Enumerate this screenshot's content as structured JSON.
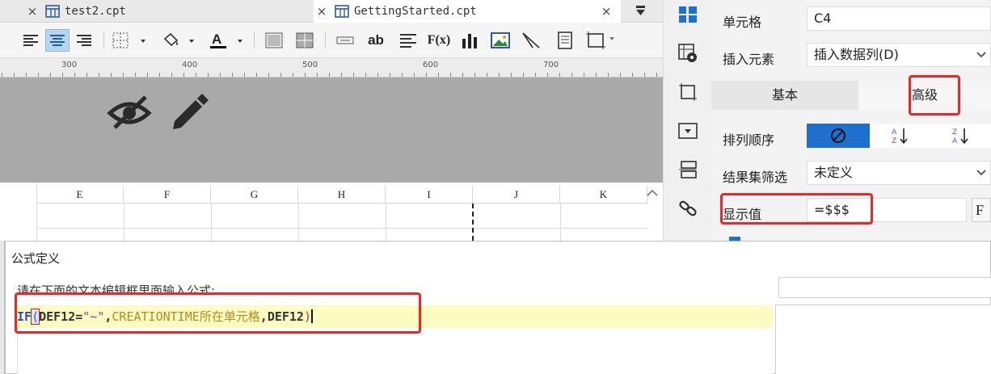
{
  "tabs": [
    {
      "name": "test2.cpt",
      "close": "×"
    },
    {
      "name": "GettingStarted.cpt",
      "close": "×"
    }
  ],
  "ruler": {
    "labels": [
      "300",
      "400",
      "500",
      "600",
      "700"
    ]
  },
  "toolbar": {
    "text_icon_ab": "ab",
    "formula_icon": "F(x)"
  },
  "grid": {
    "columns": [
      "E",
      "F",
      "G",
      "H",
      "I",
      "J",
      "K"
    ]
  },
  "props": {
    "cell_label": "单元格",
    "cell_value": "C4",
    "insert_label": "插入元素",
    "insert_value": "插入数据列(D)",
    "tab_basic": "基本",
    "tab_advanced": "高级",
    "sort_label": "排列顺序",
    "filter_label": "结果集筛选",
    "filter_value": "未定义",
    "display_label": "显示值",
    "display_value": "=$$$",
    "display_fx": "F"
  },
  "dialog": {
    "title": "公式定义",
    "prompt": "请在下面的文本编辑框里面输入公式:",
    "formula": {
      "fn": "IF",
      "open_paren": "(",
      "arg1": "DEF12=",
      "str": "\"~\"",
      "comma1": ",",
      "ident": "CREATIONTIME所在单元格",
      "comma2": ",",
      "arg3": "DEF12",
      "close_paren": ")"
    }
  },
  "colors": {
    "highlight": "#e8282b",
    "accent": "#1f6fd1",
    "editor_bg": "#fbfbc2"
  }
}
